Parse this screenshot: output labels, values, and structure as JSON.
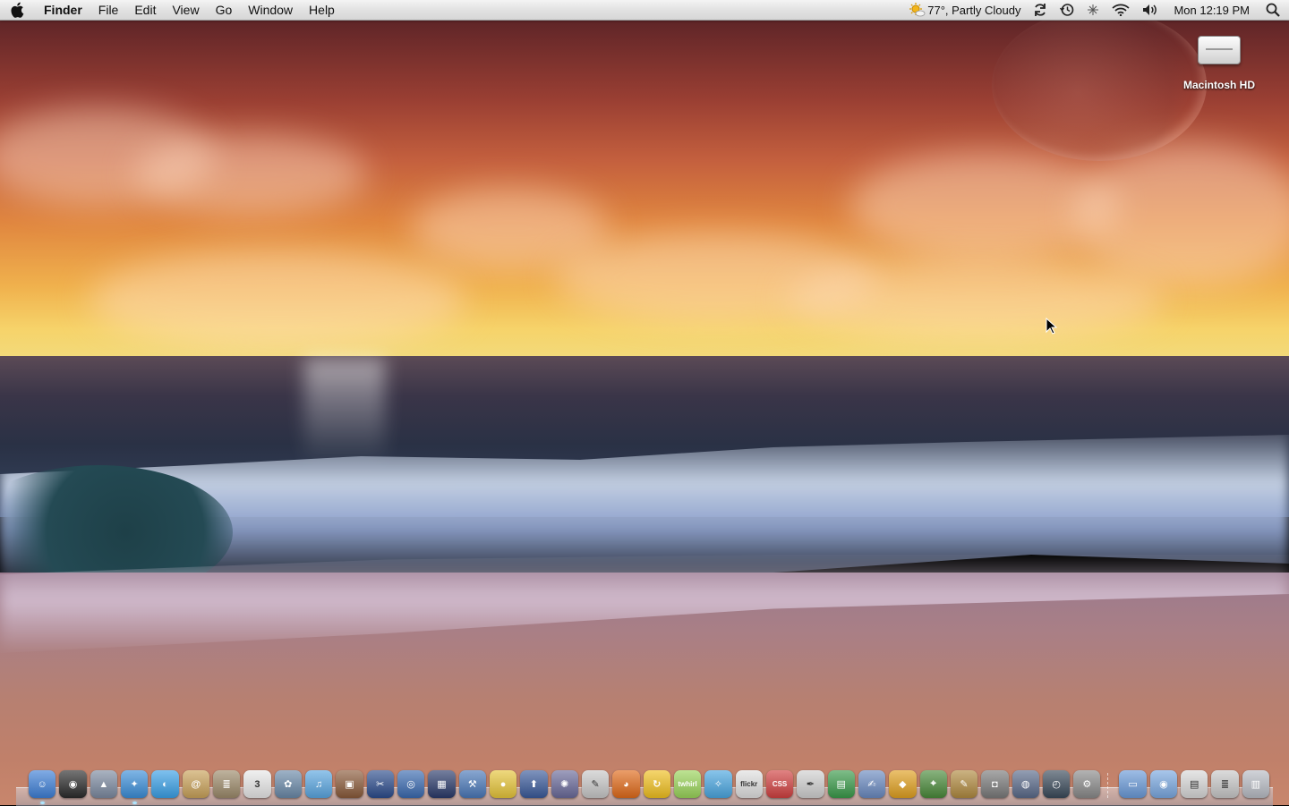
{
  "menubar": {
    "app_name": "Finder",
    "menus": [
      "File",
      "Edit",
      "View",
      "Go",
      "Window",
      "Help"
    ],
    "weather": "77°, Partly Cloudy",
    "clock": "Mon 12:19 PM"
  },
  "desktop": {
    "icons": [
      {
        "label": "Macintosh HD",
        "icon": "hard-drive-icon"
      }
    ]
  },
  "dock": {
    "apps": [
      {
        "name": "finder",
        "color": "#3e7fd6",
        "glyph": "☺",
        "running": true
      },
      {
        "name": "dashboard",
        "color": "#2b2b2b",
        "glyph": "◉"
      },
      {
        "name": "system-tool",
        "color": "#7c8aa0",
        "glyph": "▲"
      },
      {
        "name": "safari",
        "color": "#3b8ed8",
        "glyph": "✦",
        "running": true
      },
      {
        "name": "ichat",
        "color": "#3aa0e6",
        "glyph": "◐"
      },
      {
        "name": "address-book",
        "color": "#c9a25a",
        "glyph": "@"
      },
      {
        "name": "newspaper",
        "color": "#9c8a6a",
        "glyph": "≣"
      },
      {
        "name": "ical",
        "color": "#e8e8e8",
        "glyph": "3"
      },
      {
        "name": "iphoto",
        "color": "#6a89a8",
        "glyph": "✿"
      },
      {
        "name": "itunes",
        "color": "#5aa6e0",
        "glyph": "♫"
      },
      {
        "name": "preview",
        "color": "#8a5a3a",
        "glyph": "▣"
      },
      {
        "name": "imovie",
        "color": "#2c4c8c",
        "glyph": "✂"
      },
      {
        "name": "idvd",
        "color": "#3a6ab0",
        "glyph": "◎"
      },
      {
        "name": "spaces",
        "color": "#2a3a6a",
        "glyph": "▦"
      },
      {
        "name": "xcode",
        "color": "#4a78b8",
        "glyph": "⚒"
      },
      {
        "name": "cyberduck",
        "color": "#e6c53a",
        "glyph": "●"
      },
      {
        "name": "transmit",
        "color": "#3a5a9a",
        "glyph": "⬆"
      },
      {
        "name": "isync",
        "color": "#6a6a9a",
        "glyph": "✺"
      },
      {
        "name": "textedit",
        "color": "#c8c8c8",
        "glyph": "✎"
      },
      {
        "name": "firefox",
        "color": "#e06a1a",
        "glyph": "◕"
      },
      {
        "name": "sync",
        "color": "#f0c020",
        "glyph": "↻"
      },
      {
        "name": "twhirl",
        "color": "#9ad45a",
        "glyph": "twhirl"
      },
      {
        "name": "twitterrific",
        "color": "#4aa6e0",
        "glyph": "✧"
      },
      {
        "name": "flickr-uploadr",
        "color": "#e0e0e0",
        "glyph": "flickr"
      },
      {
        "name": "cssedit",
        "color": "#d04040",
        "glyph": "CSS"
      },
      {
        "name": "coda",
        "color": "#d0d0d0",
        "glyph": "✒"
      },
      {
        "name": "numbers",
        "color": "#3a9a4a",
        "glyph": "▤"
      },
      {
        "name": "pages",
        "color": "#6a8ac0",
        "glyph": "✍"
      },
      {
        "name": "keynote",
        "color": "#e0a020",
        "glyph": "◆"
      },
      {
        "name": "maps",
        "color": "#4a8a3a",
        "glyph": "⌖"
      },
      {
        "name": "photo-booth",
        "color": "#b08a40",
        "glyph": "✎"
      },
      {
        "name": "image-capture",
        "color": "#7a7a7a",
        "glyph": "◘"
      },
      {
        "name": "network",
        "color": "#5a6a8a",
        "glyph": "◍"
      },
      {
        "name": "time-machine",
        "color": "#3a4a5a",
        "glyph": "◴"
      },
      {
        "name": "system-preferences",
        "color": "#8a8a8a",
        "glyph": "⚙"
      }
    ],
    "stacks": [
      {
        "name": "applications-folder",
        "color": "#6a9ad8",
        "glyph": "▭"
      },
      {
        "name": "documents-folder",
        "color": "#7aa8e0",
        "glyph": "◉"
      },
      {
        "name": "downloads-stack",
        "color": "#d8d8d8",
        "glyph": "▤"
      },
      {
        "name": "documents-stack",
        "color": "#c8c8c8",
        "glyph": "≣"
      },
      {
        "name": "trash",
        "color": "#b8bcc4",
        "glyph": "▥"
      }
    ]
  }
}
